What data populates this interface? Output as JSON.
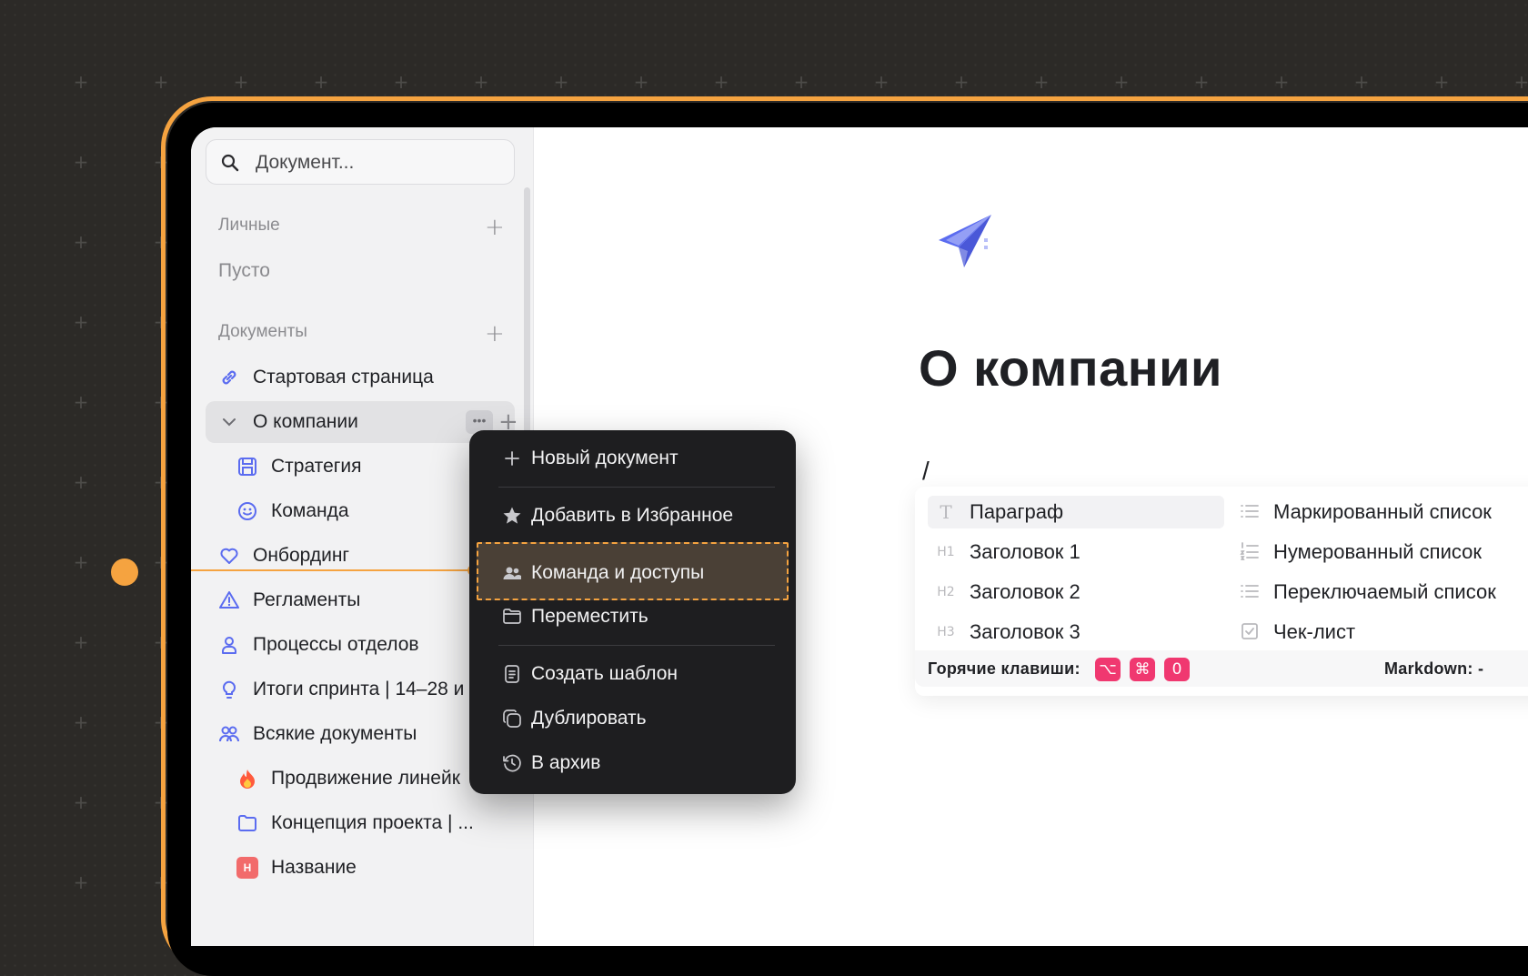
{
  "sidebar": {
    "search_placeholder": "Документ...",
    "personal_label": "Личные",
    "personal_empty": "Пусто",
    "documents_label": "Документы",
    "items": [
      {
        "label": "Стартовая страница",
        "icon": "link-icon"
      },
      {
        "label": "О компании",
        "icon": "chevron-down-icon"
      },
      {
        "label": "Стратегия",
        "icon": "save-icon"
      },
      {
        "label": "Команда",
        "icon": "smile-icon"
      },
      {
        "label": "Онбординг",
        "icon": "heart-icon"
      },
      {
        "label": "Регламенты",
        "icon": "warning-icon"
      },
      {
        "label": "Процессы отделов",
        "icon": "user-icon"
      },
      {
        "label": "Итоги спринта | 14–28 и",
        "icon": "lightbulb-icon"
      },
      {
        "label": "Всякие документы",
        "icon": "users-icon"
      },
      {
        "label": "Продвижение линейк",
        "icon": "fire-emoji-icon"
      },
      {
        "label": "Концепция проекта | ...",
        "icon": "folder-icon"
      },
      {
        "label": "Название",
        "icon": "h-badge-icon",
        "badge": "Н"
      }
    ]
  },
  "context_menu": {
    "items": [
      {
        "label": "Новый документ",
        "icon": "plus-icon"
      },
      {
        "label": "Добавить в Избранное",
        "icon": "star-icon"
      },
      {
        "label": "Команда и доступы",
        "icon": "people-icon"
      },
      {
        "label": "Переместить",
        "icon": "folder-icon"
      },
      {
        "label": "Создать шаблон",
        "icon": "document-icon"
      },
      {
        "label": "Дублировать",
        "icon": "duplicate-icon"
      },
      {
        "label": "В архив",
        "icon": "history-icon"
      }
    ]
  },
  "document": {
    "title": "О компании",
    "slash": "/"
  },
  "block_menu": {
    "items": [
      {
        "label": "Параграф",
        "icon_text": "T"
      },
      {
        "label": "Заголовок 1",
        "icon_text": "H1"
      },
      {
        "label": "Заголовок 2",
        "icon_text": "H2"
      },
      {
        "label": "Заголовок 3",
        "icon_text": "H3"
      },
      {
        "label": "Маркированный список",
        "icon": "bullet-list-icon"
      },
      {
        "label": "Нумерованный список",
        "icon": "numbered-list-icon"
      },
      {
        "label": "Переключаемый список",
        "icon": "toggle-list-icon"
      },
      {
        "label": "Чек-лист",
        "icon": "checklist-icon"
      }
    ],
    "hotkeys_label": "Горячие клавиши:",
    "hotkeys": [
      "⌥",
      "⌘",
      "0"
    ],
    "markdown_label": "Markdown:  -"
  },
  "colors": {
    "accent_orange": "#f5a340",
    "key_pink": "#f03870",
    "icon_blue": "#5b6cf0"
  }
}
